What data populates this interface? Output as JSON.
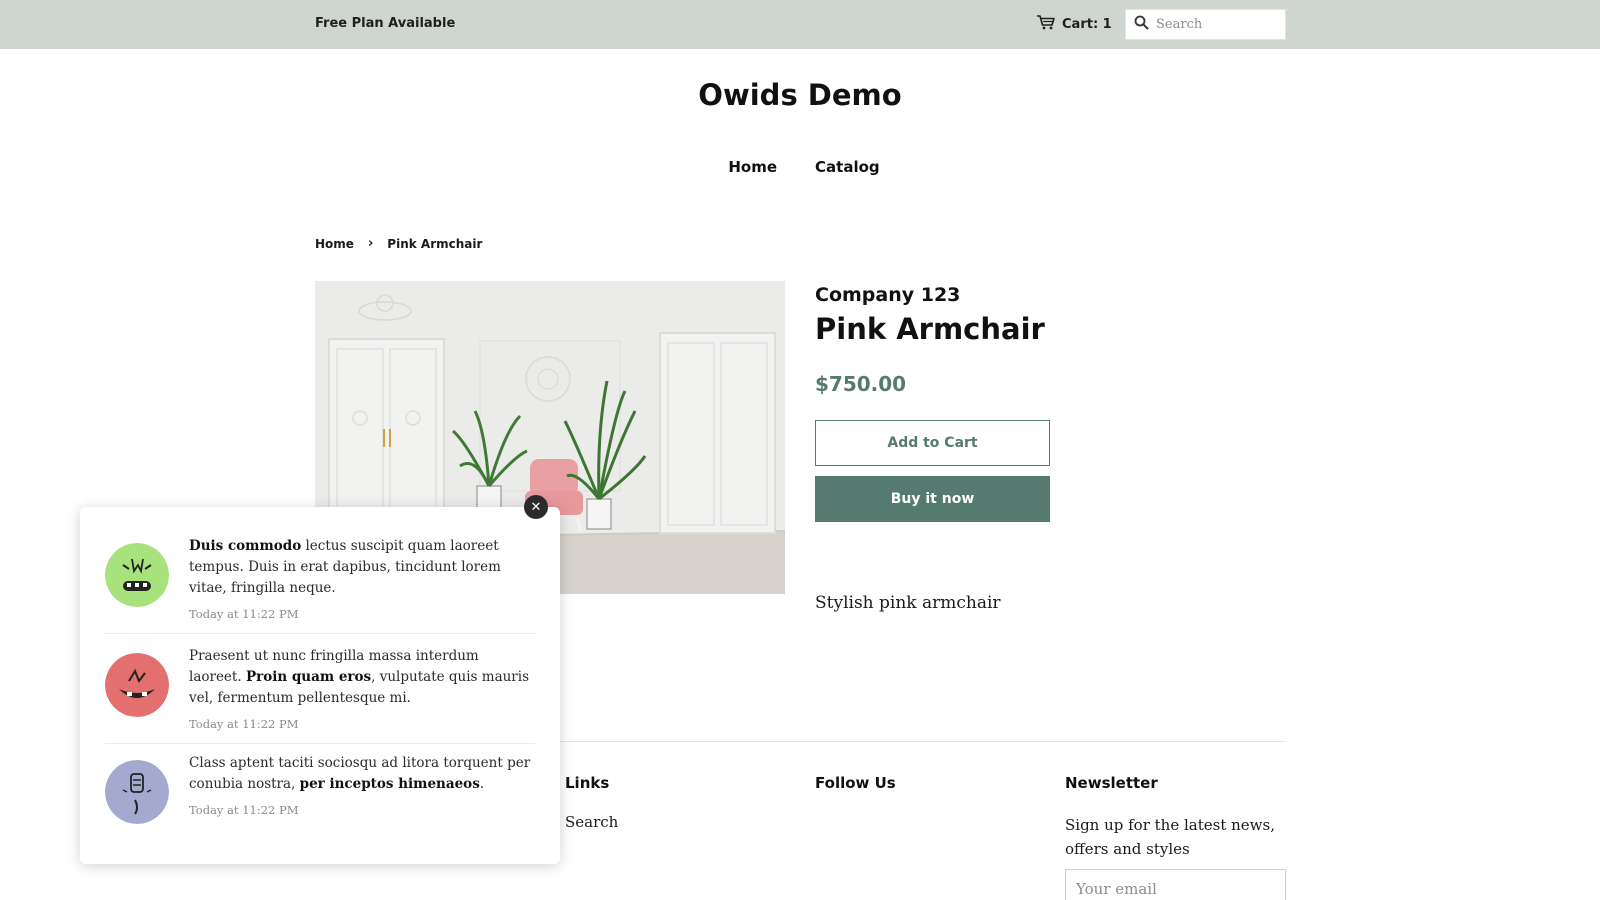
{
  "topbar": {
    "announcement": "Free Plan Available",
    "cart_label": "Cart: 1",
    "search_placeholder": "Search"
  },
  "header": {
    "site_title": "Owids Demo",
    "nav": [
      "Home",
      "Catalog"
    ]
  },
  "breadcrumb": {
    "home": "Home",
    "separator": "›",
    "current": "Pink Armchair"
  },
  "product": {
    "vendor": "Company 123",
    "title": "Pink Armchair",
    "price": "$750.00",
    "add_to_cart": "Add to Cart",
    "buy_now": "Buy it now",
    "description": "Stylish pink armchair"
  },
  "footer": {
    "links_title": "Links",
    "links": [
      "Search"
    ],
    "follow_title": "Follow Us",
    "newsletter_title": "Newsletter",
    "newsletter_text": "Sign up for the latest news, offers and styles",
    "email_placeholder": "Your email"
  },
  "popup": {
    "close_symbol": "✕",
    "notifications": [
      {
        "avatar_color": "#a8e27d",
        "bold_lead": "Duis commodo",
        "text_after": " lectus suscipit quam laoreet tempus. Duis in erat dapibus, tincidunt lorem vitae, fringilla neque.",
        "time": "Today at 11:22 PM"
      },
      {
        "avatar_color": "#e46f6f",
        "text_before": "Praesent ut nunc fringilla massa interdum laoreet. ",
        "bold_mid": "Proin quam eros",
        "text_after": ", vulputate quis mauris vel, fermentum pellentesque mi.",
        "time": "Today at 11:22 PM"
      },
      {
        "avatar_color": "#a3a9cf",
        "text_before": "Class aptent taciti sociosqu ad litora torquent per conubia nostra, ",
        "bold_mid": "per inceptos himenaeos",
        "text_after": ".",
        "time": "Today at 11:22 PM"
      }
    ]
  },
  "colors": {
    "accent": "#557b70",
    "topbar_bg": "#ced6cf"
  }
}
